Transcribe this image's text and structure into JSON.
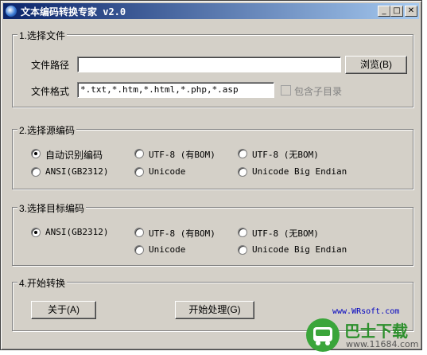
{
  "window": {
    "title": "文本编码转换专家 v2.0",
    "controls": {
      "minimize": "_",
      "maximize": "□",
      "close": "✕"
    }
  },
  "file_group": {
    "legend": "1.选择文件",
    "path_label": "文件路径",
    "path_value": "",
    "browse_button": "浏览(B)",
    "format_label": "文件格式",
    "format_value": "*.txt,*.htm,*.html,*.php,*.asp",
    "include_subdirs_label": "包含子目录",
    "include_subdirs_checked": false
  },
  "source_group": {
    "legend": "2.选择源编码",
    "options": [
      {
        "label": "自动识别编码",
        "selected": true
      },
      {
        "label": "UTF-8 (有BOM)",
        "selected": false
      },
      {
        "label": "UTF-8 (无BOM)",
        "selected": false
      },
      {
        "label": "ANSI(GB2312)",
        "selected": false
      },
      {
        "label": "Unicode",
        "selected": false
      },
      {
        "label": "Unicode Big Endian",
        "selected": false
      }
    ]
  },
  "target_group": {
    "legend": "3.选择目标编码",
    "options": [
      {
        "label": "ANSI(GB2312)",
        "selected": true
      },
      {
        "label": "UTF-8 (有BOM)",
        "selected": false
      },
      {
        "label": "UTF-8 (无BOM)",
        "selected": false
      },
      {
        "label": "Unicode",
        "selected": false
      },
      {
        "label": "Unicode Big Endian",
        "selected": false
      }
    ]
  },
  "convert_group": {
    "legend": "4.开始转换",
    "about_button": "关于(A)",
    "start_button": "开始处理(G)",
    "link_text": "www.WRsoft.com"
  },
  "watermark": {
    "brand": "巴士下载",
    "url": "www.11684.com"
  }
}
